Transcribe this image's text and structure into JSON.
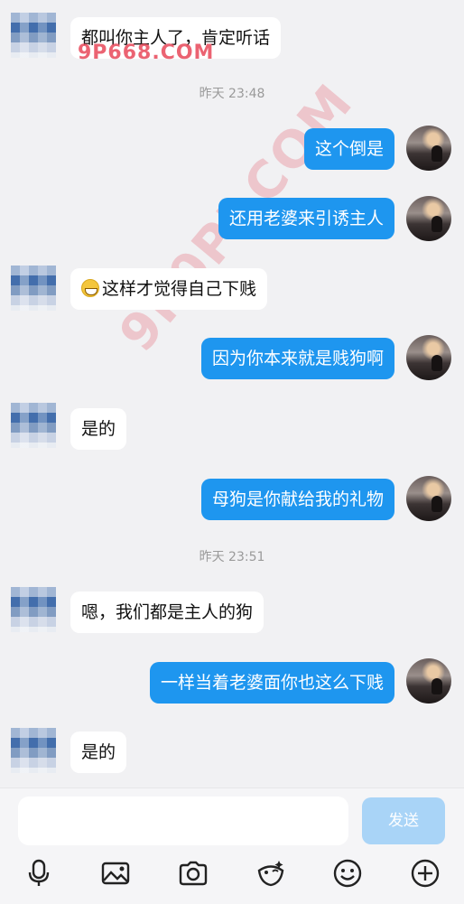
{
  "watermark": {
    "top_text": "9P668.COM",
    "diagonal_text": "9P0PI.COM"
  },
  "timestamps": [
    "昨天 23:48",
    "昨天 23:51"
  ],
  "messages": [
    {
      "side": "other",
      "text": "都叫你主人了，肯定听话"
    },
    {
      "side": "self",
      "text": "这个倒是"
    },
    {
      "side": "self",
      "text": "还用老婆来引诱主人"
    },
    {
      "side": "other",
      "text": "这样才觉得自己下贱"
    },
    {
      "side": "self",
      "text": "因为你本来就是贱狗啊"
    },
    {
      "side": "other",
      "text": "是的"
    },
    {
      "side": "self",
      "text": "母狗是你献给我的礼物"
    },
    {
      "side": "other",
      "text": "嗯，我们都是主人的狗"
    },
    {
      "side": "self",
      "text": "一样当着老婆面你也这么下贱"
    },
    {
      "side": "other",
      "text": "是的"
    }
  ],
  "composer": {
    "placeholder": "",
    "send_label": "发送"
  },
  "toolbar": {
    "icons": [
      "microphone-icon",
      "image-icon",
      "camera-icon",
      "sticker-icon",
      "emoji-icon",
      "plus-icon"
    ]
  },
  "colors": {
    "self_bubble": "#1e96ef",
    "other_bubble": "#ffffff",
    "background": "#f1f1f3",
    "send_button": "#a9d4f7"
  }
}
